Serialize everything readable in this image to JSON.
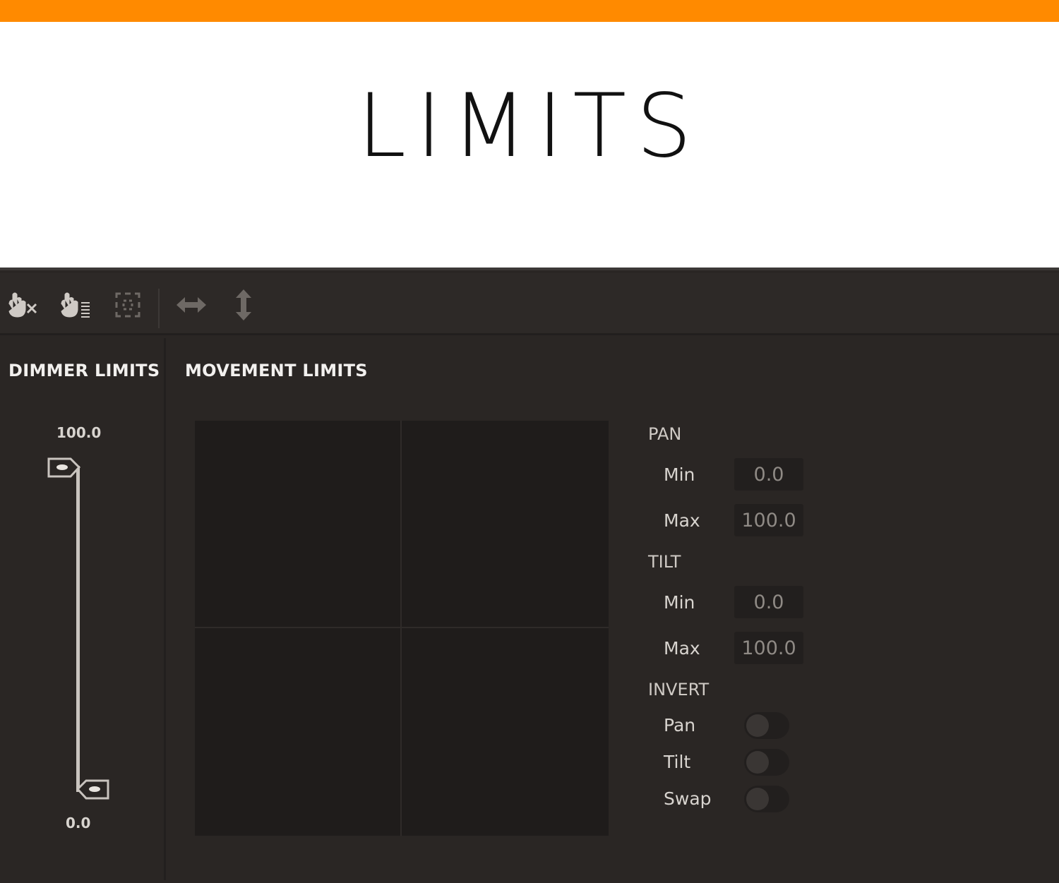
{
  "banner": {
    "accent_color": "#ff8a00",
    "title": "LIMITS"
  },
  "toolbar": {
    "buttons": [
      {
        "icon": "dimmer-clear-icon",
        "enabled": true
      },
      {
        "icon": "dimmer-levels-icon",
        "enabled": true
      },
      {
        "icon": "selection-grid-icon",
        "enabled": false
      },
      {
        "icon": "horizontal-arrows-icon",
        "enabled": false
      },
      {
        "icon": "vertical-arrows-icon",
        "enabled": false
      }
    ]
  },
  "dimmer": {
    "title": "DIMMER LIMITS",
    "max_label": "100.0",
    "min_label": "0.0",
    "max_value": 100.0,
    "min_value": 0.0
  },
  "movement": {
    "title": "MOVEMENT LIMITS",
    "pan": {
      "label": "PAN",
      "min_label": "Min",
      "min_value": "0.0",
      "max_label": "Max",
      "max_value": "100.0"
    },
    "tilt": {
      "label": "TILT",
      "min_label": "Min",
      "min_value": "0.0",
      "max_label": "Max",
      "max_value": "100.0"
    },
    "invert": {
      "label": "INVERT",
      "pan_label": "Pan",
      "pan_on": false,
      "tilt_label": "Tilt",
      "tilt_on": false,
      "swap_label": "Swap",
      "swap_on": false
    }
  },
  "colors": {
    "panel_bg": "#2a2624",
    "pad_bg": "#1f1c1b",
    "text_light": "#f2f0ee",
    "field_text": "#8f8a85"
  }
}
